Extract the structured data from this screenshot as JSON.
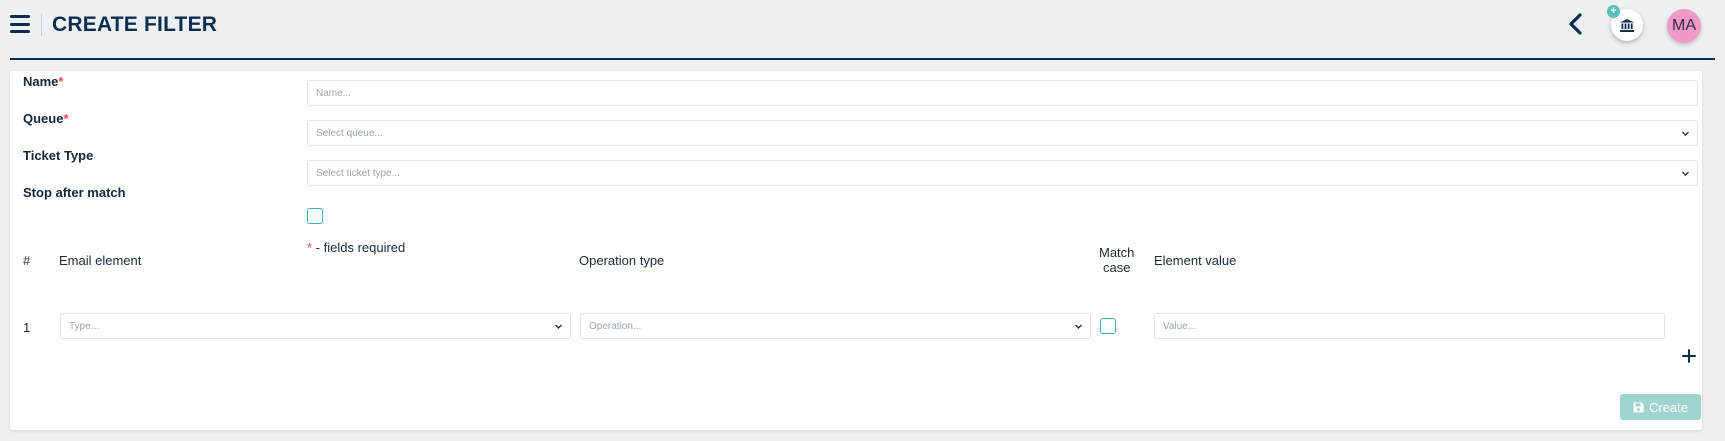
{
  "header": {
    "title": "CREATE FILTER",
    "avatar_initials": "MA",
    "menu_icon": "hamburger-menu-icon",
    "back_icon": "chevron-left-icon",
    "org_icon": "bank-icon",
    "org_badge": "+"
  },
  "form": {
    "name": {
      "label": "Name",
      "required_mark": "*",
      "placeholder": "Name..."
    },
    "queue": {
      "label": "Queue",
      "required_mark": "*",
      "placeholder": "Select queue..."
    },
    "ticket_type": {
      "label": "Ticket Type",
      "placeholder": "Select ticket type..."
    },
    "stop_after_match": {
      "label": "Stop after match",
      "checked": false
    },
    "required_hint_mark": "*",
    "required_hint_text": " - fields required"
  },
  "rules": {
    "columns": {
      "index": "#",
      "email_element": "Email element",
      "operation_type": "Operation type",
      "match_case_line1": "Match",
      "match_case_line2": "case",
      "element_value": "Element value"
    },
    "rows": [
      {
        "index": "1",
        "email_element_placeholder": "Type...",
        "operation_placeholder": "Operation...",
        "match_case": false,
        "value_placeholder": "Value..."
      }
    ],
    "add_icon": "plus-icon"
  },
  "actions": {
    "create_label": "Create",
    "create_icon": "save-icon"
  },
  "colors": {
    "navy": "#0d2d4f",
    "teal": "#3fb1a8",
    "create_bg": "#9fd4cf",
    "avatar_bg": "#f19ac8",
    "required": "#e5484d"
  }
}
